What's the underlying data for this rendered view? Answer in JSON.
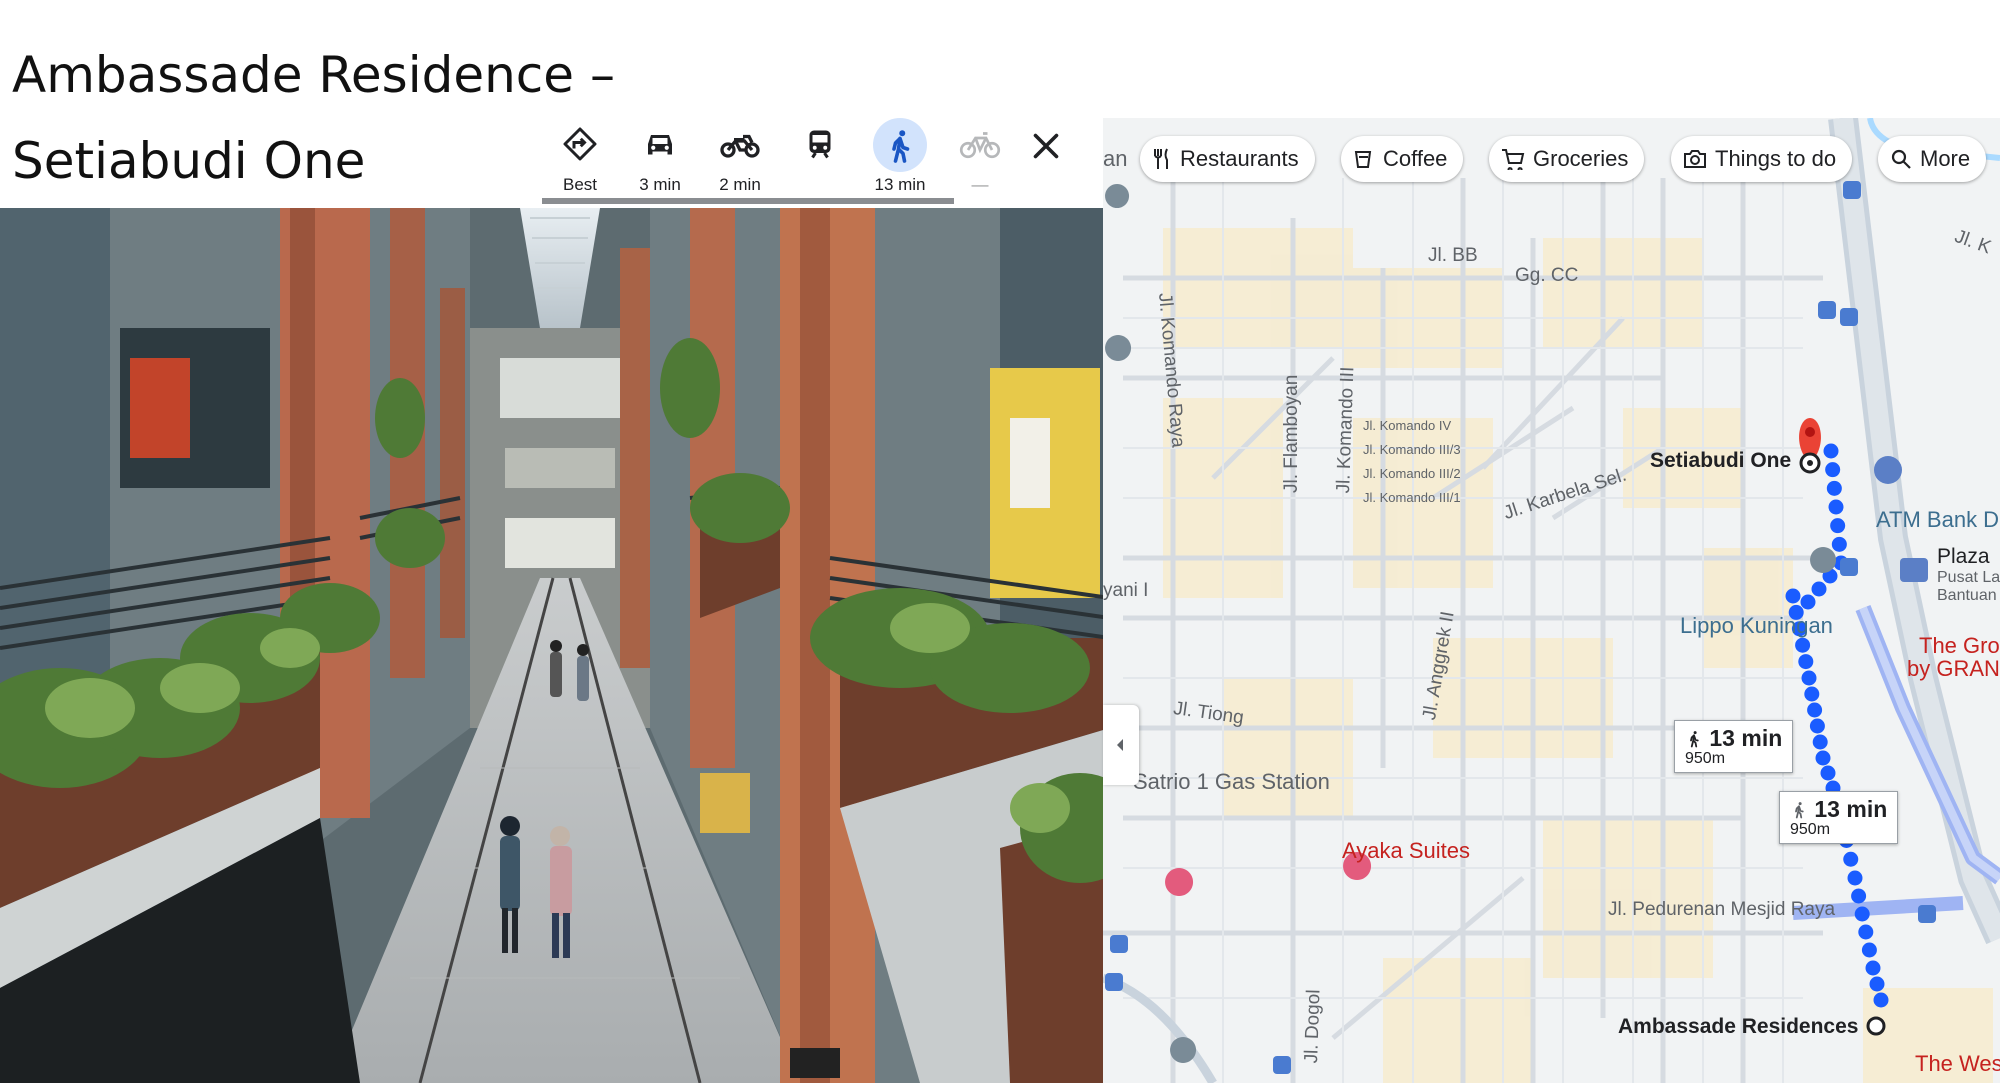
{
  "slide": {
    "title_line1": "Ambassade Residence –",
    "title_line2": "Setiabudi One"
  },
  "travel_modes": [
    {
      "id": "best",
      "label": "Best",
      "icon": "directions-icon",
      "active": false
    },
    {
      "id": "drive",
      "label": "3 min",
      "icon": "car-icon",
      "active": false
    },
    {
      "id": "motorcycle",
      "label": "2 min",
      "icon": "motorcycle-icon",
      "active": false
    },
    {
      "id": "transit",
      "label": "",
      "icon": "train-icon",
      "active": false
    },
    {
      "id": "walk",
      "label": "13 min",
      "icon": "walk-icon",
      "active": true
    },
    {
      "id": "bike",
      "label": "—",
      "icon": "bicycle-icon",
      "active": false
    }
  ],
  "map": {
    "chips": [
      {
        "label": "Restaurants",
        "icon": "fork-knife-icon"
      },
      {
        "label": "Coffee",
        "icon": "coffee-icon"
      },
      {
        "label": "Groceries",
        "icon": "cart-icon"
      },
      {
        "label": "Things to do",
        "icon": "camera-icon"
      },
      {
        "label": "More",
        "icon": "search-icon"
      }
    ],
    "chip_prefix": "an",
    "streets": {
      "bb": "Jl. BB",
      "cc": "Gg. CC",
      "komando_raya": "Jl. Komando Raya",
      "flamboyan": "Jl. Flamboyan",
      "komando_iii": "Jl. Komando III",
      "komando_iv": "Jl. Komando IV",
      "komando_iii3": "Jl. Komando III/3",
      "komando_iii2": "Jl. Komando III/2",
      "komando_iii1": "Jl. Komando III/1",
      "karbela": "Jl. Karbela Sel.",
      "anggrek": "Jl. Anggrek II",
      "tiong": "Jl. Tiong",
      "yani": "yani I",
      "pedurenan": "Jl. Pedurenan Mesjid Raya",
      "dogol": "Jl. Dogol",
      "k_right": "Jl. K"
    },
    "places": {
      "setiabudi_one": "Setiabudi One",
      "ambassade": "Ambassade Residences",
      "lippo": "Lippo Kuningan",
      "atm": "ATM Bank D",
      "plaza": "Plaza",
      "pusat": "Pusat La",
      "bantuan": "Bantuan",
      "grove1": "The Grov",
      "grove2": "by GRAND",
      "gas": "Satrio 1 Gas Station",
      "ayaka": "Ayaka Suites",
      "west": "The Wes"
    },
    "callouts": [
      {
        "time": "13 min",
        "distance": "950m"
      },
      {
        "time": "13 min",
        "distance": "950m"
      }
    ],
    "colors": {
      "route": "#1a5cff",
      "alt_route": "#9fb4f3",
      "pin": "#ea4335",
      "water": "#aadaff"
    }
  }
}
